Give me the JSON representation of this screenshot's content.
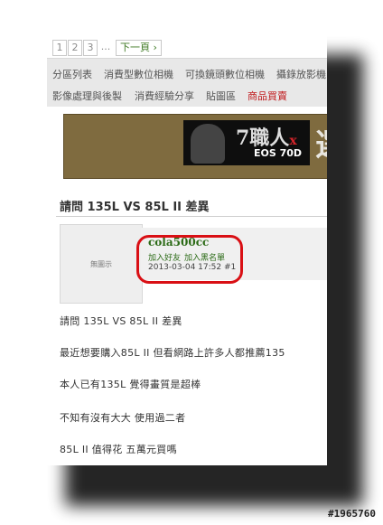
{
  "pagination": {
    "pages": [
      "1",
      "2",
      "3"
    ],
    "ellipsis": "...",
    "next_label": "下一頁 ›"
  },
  "nav": {
    "items": [
      "分區列表",
      "消費型數位相機",
      "可換鏡頭數位相機",
      "攝錄放影機",
      "影像處理與後製",
      "消費經驗分享",
      "貼圖區",
      "商品買賣"
    ]
  },
  "banner": {
    "title": "7職人",
    "x": "x",
    "subtitle": "EOS 70D",
    "big_char": "選"
  },
  "post": {
    "title": "請問 135L VS 85L II 差異",
    "avatar_text": "無圖示",
    "username": "cola500cc",
    "add_friend": "加入好友",
    "blacklist": "加入黑名單",
    "datetime": "2013-03-04 17:52",
    "floor": "#1",
    "body": [
      "請問 135L VS 85L II 差異",
      "最近想要購入85L II 但看網路上許多人都推薦135",
      "本人已有135L 覺得畫質是超棒",
      "不知有沒有大大 使用過二者",
      "85L II 值得花 五萬元買嗎"
    ]
  },
  "watermark": "#1965760",
  "colors": {
    "accent_green": "#2c6b17",
    "highlight_red": "#d90f14",
    "nav_bg": "#e8e8e8"
  }
}
